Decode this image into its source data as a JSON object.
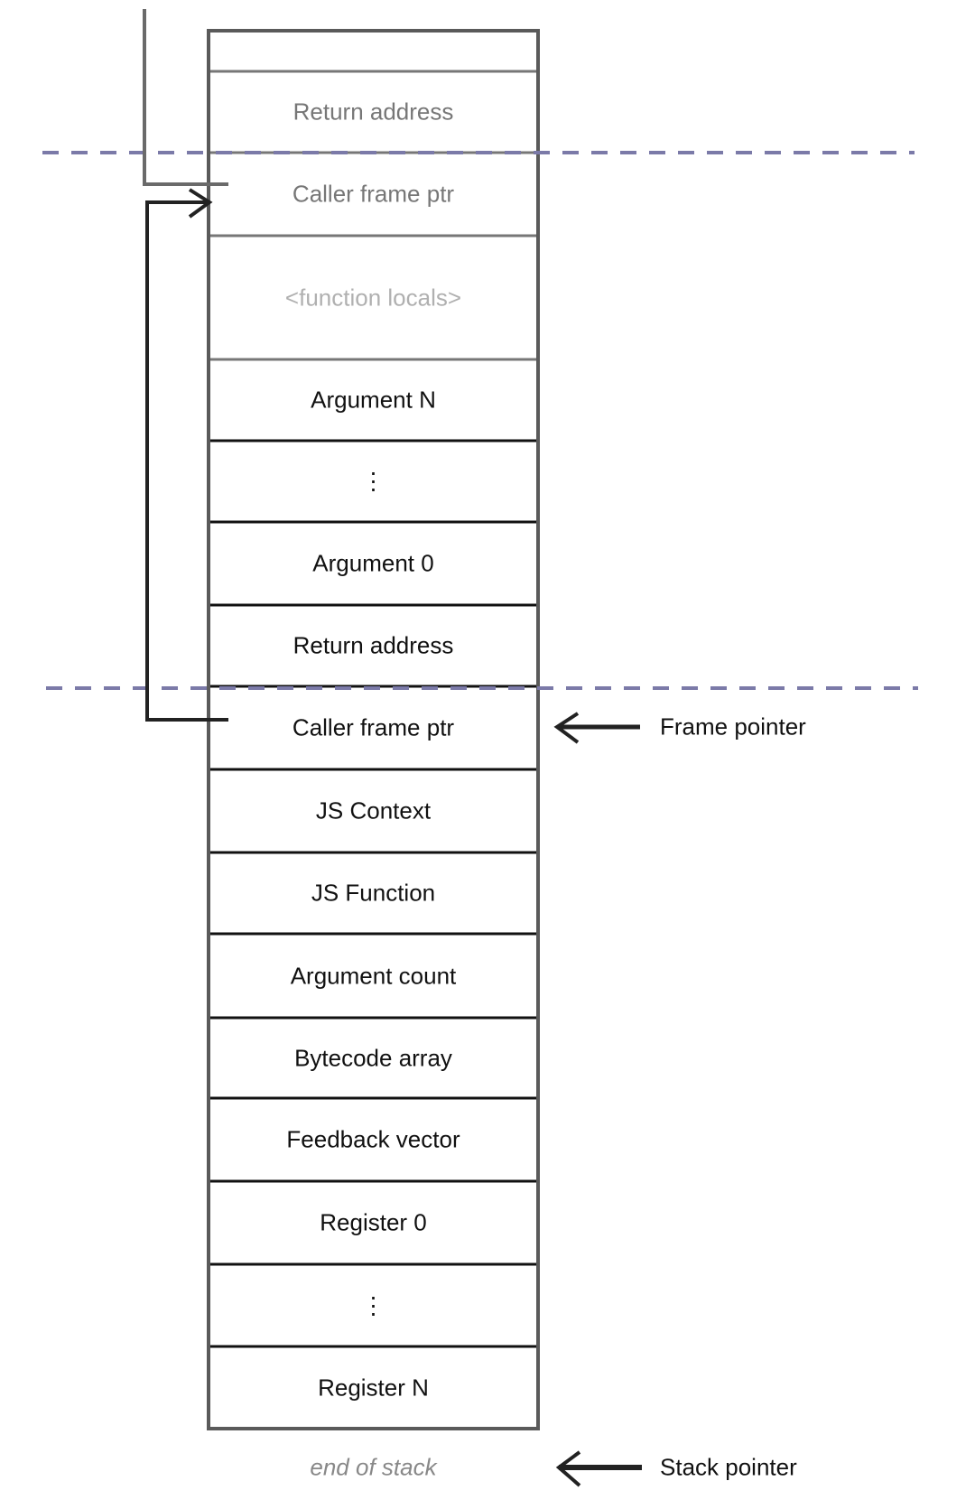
{
  "slots": [
    {
      "label": "",
      "style": "grey"
    },
    {
      "label": "Return address",
      "style": "grey"
    },
    {
      "label": "Caller frame ptr",
      "style": "grey"
    },
    {
      "label": "<function locals>",
      "style": "faint"
    },
    {
      "label": "Argument N",
      "style": "normal"
    },
    {
      "label": "⋮",
      "style": "normal"
    },
    {
      "label": "Argument 0",
      "style": "normal"
    },
    {
      "label": "Return address",
      "style": "normal"
    },
    {
      "label": "Caller frame ptr",
      "style": "normal"
    },
    {
      "label": "JS Context",
      "style": "normal"
    },
    {
      "label": "JS Function",
      "style": "normal"
    },
    {
      "label": "Argument count",
      "style": "normal"
    },
    {
      "label": "Bytecode array",
      "style": "normal"
    },
    {
      "label": "Feedback vector",
      "style": "normal"
    },
    {
      "label": "Register 0",
      "style": "normal"
    },
    {
      "label": "⋮",
      "style": "normal"
    },
    {
      "label": "Register N",
      "style": "normal"
    }
  ],
  "end_of_stack": "end of stack",
  "pointers": {
    "frame_pointer": "Frame pointer",
    "stack_pointer": "Stack pointer"
  },
  "colors": {
    "frame_divider": "#7b7aa8",
    "line": "#111111",
    "grey_line": "#6a6a6a"
  }
}
